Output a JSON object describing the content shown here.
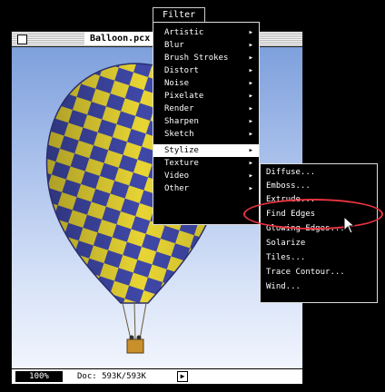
{
  "document": {
    "title": "Balloon.pcx",
    "zoom": "100%",
    "doc_size": "Doc: 593K/593K"
  },
  "menu": {
    "title": "Filter",
    "items": [
      {
        "label": "Artistic",
        "submenu": true
      },
      {
        "label": "Blur",
        "submenu": true
      },
      {
        "label": "Brush Strokes",
        "submenu": true
      },
      {
        "label": "Distort",
        "submenu": true
      },
      {
        "label": "Noise",
        "submenu": true
      },
      {
        "label": "Pixelate",
        "submenu": true
      },
      {
        "label": "Render",
        "submenu": true
      },
      {
        "label": "Sharpen",
        "submenu": true
      },
      {
        "label": "Sketch",
        "submenu": true
      },
      {
        "label": "Stylize",
        "submenu": true,
        "selected": true
      },
      {
        "label": "Texture",
        "submenu": true
      },
      {
        "label": "Video",
        "submenu": true
      },
      {
        "label": "Other",
        "submenu": true
      }
    ]
  },
  "submenu": {
    "items": [
      {
        "label": "Diffuse..."
      },
      {
        "label": "Emboss..."
      },
      {
        "label": "Extrude..."
      },
      {
        "label": "Find Edges",
        "highlighted": true
      },
      {
        "label": "Glowing Edges..."
      },
      {
        "label": "Solarize"
      },
      {
        "label": "Tiles..."
      },
      {
        "label": "Trace Contour..."
      },
      {
        "label": "Wind..."
      }
    ]
  },
  "colors": {
    "balloon_yellow": "#e8d534",
    "balloon_blue": "#3f48a8",
    "highlight_ring": "#e8333f"
  }
}
